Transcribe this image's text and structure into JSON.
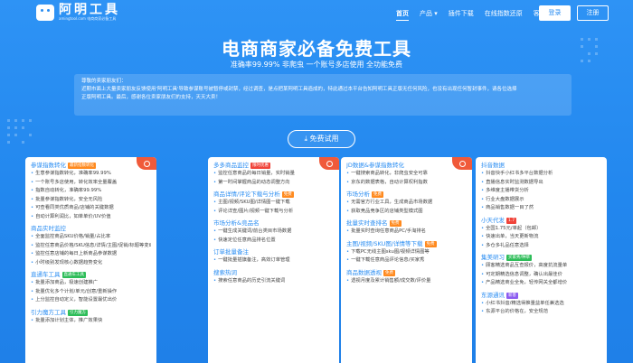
{
  "nav": {
    "logo_text": "阿明工具",
    "logo_sub": "amingtool.com 电商商家必备工具",
    "links": [
      "首页",
      "产品 ▾",
      "插件下载",
      "在线指数还原",
      "客服"
    ],
    "login": "登录",
    "register": "注册"
  },
  "hero": {
    "title": "电商商家必备免费工具",
    "subtitle": "准确率99.99%  非爬虫  一个账号多店使用  全功能免费",
    "trial_button": "免费试用"
  },
  "notice": {
    "lines": [
      "尊敬的卖家朋友们：",
      "近期市面上大量卖家朋友反馈使用'阿明工具'导致参谋账号被暂停或封禁，经过调查，是点把某阿明工具造成的，特此通过本平台告知阿明工具正版无任何风险，也没有出现任何暂封事件，请各位选择",
      "正版阿明工具。最后，感谢各位卖家朋友们的支持，天天大卖！"
    ]
  },
  "cards": [
    {
      "sections": [
        {
          "title": "参谋指数转化",
          "tag": "最新指数转化",
          "tag_color": "orange",
          "items": [
            "生意参谋指数转化，准确率99.99%",
            "一个账号多店使用，转化效率全量覆盖",
            "指数自动转化，准确率99.99%",
            "批量参谋指数转化，安全无风险",
            "可查看同类优质商品/店铺的关键数据",
            "自动计算利润比，如单单价/UV价值"
          ]
        },
        {
          "title": "商品实时监控",
          "tag": "",
          "tag_color": "",
          "items": [
            "全面监控商品SKU价格/销量/占比率",
            "监控任意商品价格/SKU信息/详情/主图/促销/标题等变动",
            "监控任意店铺的每日上新商品参谋数据",
            "小时级别发现核心数据趋势变化"
          ]
        },
        {
          "title": "直通车工具",
          "tag": "直通车工具",
          "tag_color": "green",
          "items": [
            "批量添加商品，极速创建推广",
            "批量优化多个计划/单元/创意/重新操作",
            "上分监控自动定义，智能设置最优出价"
          ]
        },
        {
          "title": "引力魔方工具",
          "tag": "引力魔方",
          "tag_color": "green",
          "items": [
            "批量添加计划主体，推广效果快"
          ]
        }
      ]
    },
    {
      "sections": [
        {
          "title": "多多商品监控",
          "tag": "限时优惠",
          "tag_color": "red",
          "items": [
            "监控任意商品的每日销量，实时销量",
            "第一时间掌握商品的动态调整方向"
          ]
        },
        {
          "title": "商品详情/评论下载与分析",
          "tag": "免费",
          "tag_color": "orange",
          "items": [
            "主图/视频/SKU图/详情图一键下载",
            "评论详查/图片/视频一键下载与分析"
          ]
        },
        {
          "title": "市场分析&竞品名",
          "tag": "",
          "tag_color": "",
          "items": [
            "一键生成关键词/前台类目市场数据",
            "快速定位任意商品排名位置"
          ]
        },
        {
          "title": "订单批量备注",
          "tag": "",
          "tag_color": "",
          "items": [
            "一键批量插旗备注，高效订单管理"
          ]
        },
        {
          "title": "搜索热词",
          "tag": "",
          "tag_color": "",
          "items": [
            "搜索任意商品的历史引流关键词"
          ]
        }
      ]
    },
    {
      "sections": [
        {
          "title": "JD数据&参谋指数转化",
          "tag": "",
          "tag_color": "",
          "items": [
            "一键搜索商品转化，非爬虫安全可靠",
            "京东的数据表格，自动计算权利指数"
          ]
        },
        {
          "title": "市场分析",
          "tag": "免费",
          "tag_color": "orange",
          "items": [
            "无需官方行业工具，生成商品市场数据",
            "获取竞品竞争区的店铺类型模式图"
          ]
        },
        {
          "title": "批量实时查排名",
          "tag": "免费",
          "tag_color": "orange",
          "items": [
            "批量实时查询任意商品PC/手淘排名"
          ]
        },
        {
          "title": "主图/视频/SKU图/详情等下载",
          "tag": "免费",
          "tag_color": "orange",
          "items": [
            "下载PC无线主图sku图/视频详情图等",
            "一键下载任意商品评论信息/买家秀"
          ]
        },
        {
          "title": "商品数据透视",
          "tag": "免费",
          "tag_color": "orange",
          "items": [
            "透视月度及累计销售额/成交数/评价量"
          ]
        }
      ]
    },
    {
      "sections": [
        {
          "title": "抖音数据",
          "tag": "",
          "tag_color": "",
          "items": [
            "抖音快手小红书多平台数据分析",
            "直播信息实时监测数据导出",
            "多维度主播带货分析",
            "行业大盘数据展示",
            "商品销售数据一目了然"
          ]
        },
        {
          "title": "小天代发",
          "tag": "1.7",
          "tag_color": "red",
          "items": [
            "全国1.75元/单起（包邮）",
            "快速出单，当天更新物流",
            "多仓多礼品任意选择"
          ]
        },
        {
          "title": "集美研习",
          "tag": "买家秀/种草",
          "tag_color": "green",
          "items": [
            "顾客精选商品互查报价，高度抗流量单",
            "可定期精选信息调整，确认出最佳价",
            "产品精选商业全免，轻传网关全都增价"
          ]
        },
        {
          "title": "东源通讯",
          "tag": "新客",
          "tag_color": "purple",
          "items": [
            "小红书抖音/精选得推量益单任兼选选",
            "东源平台的价格在，安全规范"
          ]
        }
      ]
    }
  ]
}
